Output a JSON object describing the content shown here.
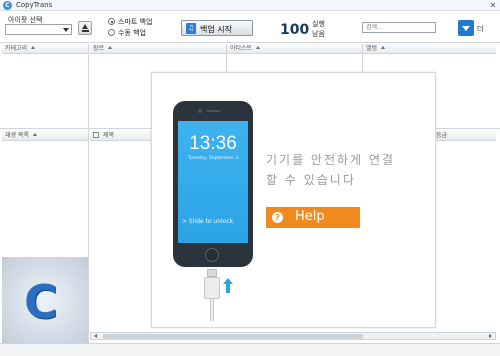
{
  "window": {
    "title": "CopyTrans",
    "close_glyph": "✕"
  },
  "toolbar": {
    "device_label": "아이팟 선택",
    "device_value": "",
    "backup_modes": [
      {
        "label": "스마트 백업",
        "selected": true
      },
      {
        "label": "수동 백업",
        "selected": false
      }
    ],
    "backup_button_label": "백업 시작",
    "backup_icon_glyph": "♫",
    "count": "100",
    "count_sub_1": "실행",
    "count_sub_2": "남음",
    "search_placeholder": "검색...",
    "menu_label": "더"
  },
  "panels": {
    "category_header": "카테고리",
    "genre_header": "장르",
    "artist_header": "아티스트",
    "album_header": "앨범",
    "playlist_header": "재생 목록",
    "track_title_header": "제목",
    "rating_header": "등급"
  },
  "overlay": {
    "phone_time": "13:36",
    "phone_date": "Tuesday, September 3",
    "slide_text": "> Slide to unlock",
    "message_line1": "기기를 안전하게 연결",
    "message_line2": "할 수 있습니다",
    "help_label": "Help",
    "help_glyph": "?"
  },
  "logo": {
    "letter": "C"
  },
  "colors": {
    "accent": "#1f7bd0",
    "help": "#f08a1f",
    "screen": "#2aa3e6"
  }
}
